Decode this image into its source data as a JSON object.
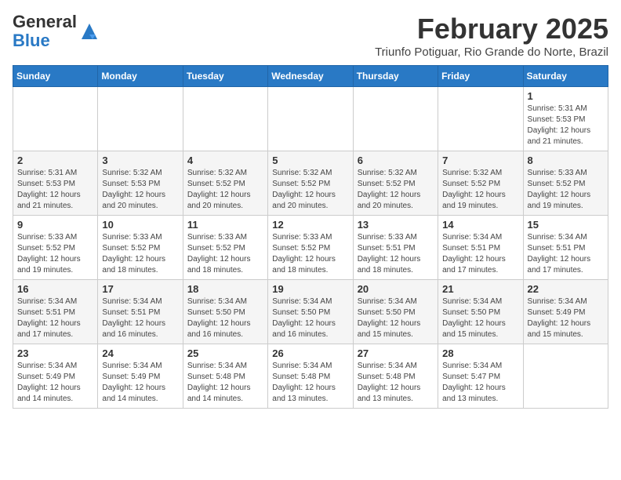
{
  "logo": {
    "general": "General",
    "blue": "Blue"
  },
  "title": "February 2025",
  "subtitle": "Triunfo Potiguar, Rio Grande do Norte, Brazil",
  "days_of_week": [
    "Sunday",
    "Monday",
    "Tuesday",
    "Wednesday",
    "Thursday",
    "Friday",
    "Saturday"
  ],
  "weeks": [
    [
      {
        "day": "",
        "info": ""
      },
      {
        "day": "",
        "info": ""
      },
      {
        "day": "",
        "info": ""
      },
      {
        "day": "",
        "info": ""
      },
      {
        "day": "",
        "info": ""
      },
      {
        "day": "",
        "info": ""
      },
      {
        "day": "1",
        "info": "Sunrise: 5:31 AM\nSunset: 5:53 PM\nDaylight: 12 hours\nand 21 minutes."
      }
    ],
    [
      {
        "day": "2",
        "info": "Sunrise: 5:31 AM\nSunset: 5:53 PM\nDaylight: 12 hours\nand 21 minutes."
      },
      {
        "day": "3",
        "info": "Sunrise: 5:32 AM\nSunset: 5:53 PM\nDaylight: 12 hours\nand 20 minutes."
      },
      {
        "day": "4",
        "info": "Sunrise: 5:32 AM\nSunset: 5:52 PM\nDaylight: 12 hours\nand 20 minutes."
      },
      {
        "day": "5",
        "info": "Sunrise: 5:32 AM\nSunset: 5:52 PM\nDaylight: 12 hours\nand 20 minutes."
      },
      {
        "day": "6",
        "info": "Sunrise: 5:32 AM\nSunset: 5:52 PM\nDaylight: 12 hours\nand 20 minutes."
      },
      {
        "day": "7",
        "info": "Sunrise: 5:32 AM\nSunset: 5:52 PM\nDaylight: 12 hours\nand 19 minutes."
      },
      {
        "day": "8",
        "info": "Sunrise: 5:33 AM\nSunset: 5:52 PM\nDaylight: 12 hours\nand 19 minutes."
      }
    ],
    [
      {
        "day": "9",
        "info": "Sunrise: 5:33 AM\nSunset: 5:52 PM\nDaylight: 12 hours\nand 19 minutes."
      },
      {
        "day": "10",
        "info": "Sunrise: 5:33 AM\nSunset: 5:52 PM\nDaylight: 12 hours\nand 18 minutes."
      },
      {
        "day": "11",
        "info": "Sunrise: 5:33 AM\nSunset: 5:52 PM\nDaylight: 12 hours\nand 18 minutes."
      },
      {
        "day": "12",
        "info": "Sunrise: 5:33 AM\nSunset: 5:52 PM\nDaylight: 12 hours\nand 18 minutes."
      },
      {
        "day": "13",
        "info": "Sunrise: 5:33 AM\nSunset: 5:51 PM\nDaylight: 12 hours\nand 18 minutes."
      },
      {
        "day": "14",
        "info": "Sunrise: 5:34 AM\nSunset: 5:51 PM\nDaylight: 12 hours\nand 17 minutes."
      },
      {
        "day": "15",
        "info": "Sunrise: 5:34 AM\nSunset: 5:51 PM\nDaylight: 12 hours\nand 17 minutes."
      }
    ],
    [
      {
        "day": "16",
        "info": "Sunrise: 5:34 AM\nSunset: 5:51 PM\nDaylight: 12 hours\nand 17 minutes."
      },
      {
        "day": "17",
        "info": "Sunrise: 5:34 AM\nSunset: 5:51 PM\nDaylight: 12 hours\nand 16 minutes."
      },
      {
        "day": "18",
        "info": "Sunrise: 5:34 AM\nSunset: 5:50 PM\nDaylight: 12 hours\nand 16 minutes."
      },
      {
        "day": "19",
        "info": "Sunrise: 5:34 AM\nSunset: 5:50 PM\nDaylight: 12 hours\nand 16 minutes."
      },
      {
        "day": "20",
        "info": "Sunrise: 5:34 AM\nSunset: 5:50 PM\nDaylight: 12 hours\nand 15 minutes."
      },
      {
        "day": "21",
        "info": "Sunrise: 5:34 AM\nSunset: 5:50 PM\nDaylight: 12 hours\nand 15 minutes."
      },
      {
        "day": "22",
        "info": "Sunrise: 5:34 AM\nSunset: 5:49 PM\nDaylight: 12 hours\nand 15 minutes."
      }
    ],
    [
      {
        "day": "23",
        "info": "Sunrise: 5:34 AM\nSunset: 5:49 PM\nDaylight: 12 hours\nand 14 minutes."
      },
      {
        "day": "24",
        "info": "Sunrise: 5:34 AM\nSunset: 5:49 PM\nDaylight: 12 hours\nand 14 minutes."
      },
      {
        "day": "25",
        "info": "Sunrise: 5:34 AM\nSunset: 5:48 PM\nDaylight: 12 hours\nand 14 minutes."
      },
      {
        "day": "26",
        "info": "Sunrise: 5:34 AM\nSunset: 5:48 PM\nDaylight: 12 hours\nand 13 minutes."
      },
      {
        "day": "27",
        "info": "Sunrise: 5:34 AM\nSunset: 5:48 PM\nDaylight: 12 hours\nand 13 minutes."
      },
      {
        "day": "28",
        "info": "Sunrise: 5:34 AM\nSunset: 5:47 PM\nDaylight: 12 hours\nand 13 minutes."
      },
      {
        "day": "",
        "info": ""
      }
    ]
  ]
}
